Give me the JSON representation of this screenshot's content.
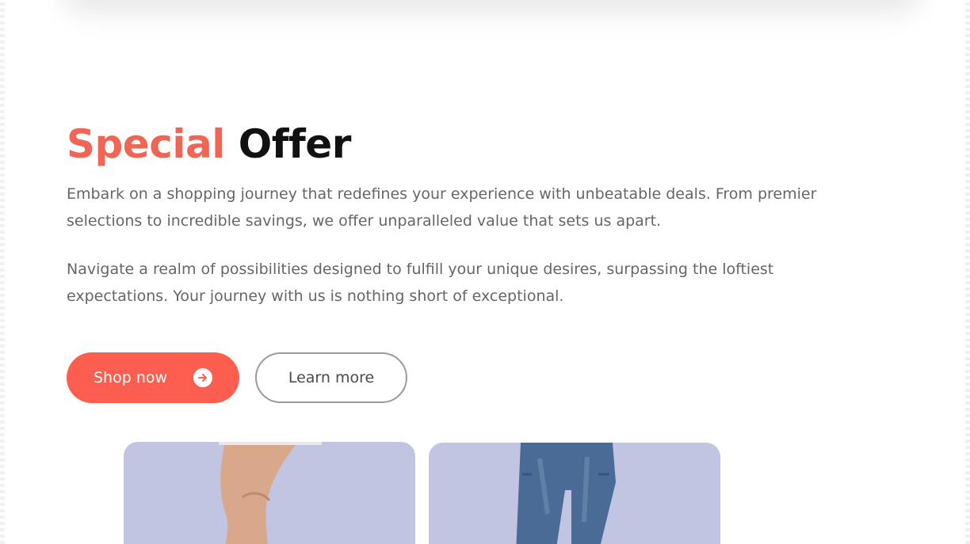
{
  "section": {
    "title_accent": "Special",
    "title_rest": "Offer",
    "paragraphs": [
      "Embark on a shopping journey that redefines your experience with unbeatable deals. From premier selections to incredible savings, we offer unparalleled value that sets us apart.",
      "Navigate a realm of possibilities designed to fulfill your unique desires, surpassing the loftiest expectations. Your journey with us is nothing short of exceptional."
    ]
  },
  "buttons": {
    "shop_now": "Shop now",
    "shop_now_icon": "arrow-right-circle-icon",
    "learn_more": "Learn more"
  },
  "products": [
    {
      "name": "product-legs",
      "background": "#c2c5e1"
    },
    {
      "name": "product-jeans",
      "background": "#c2c5e1"
    }
  ],
  "colors": {
    "accent": "#f06553",
    "button_primary": "#fd5e4f",
    "text": "#666666",
    "title": "#111111"
  }
}
